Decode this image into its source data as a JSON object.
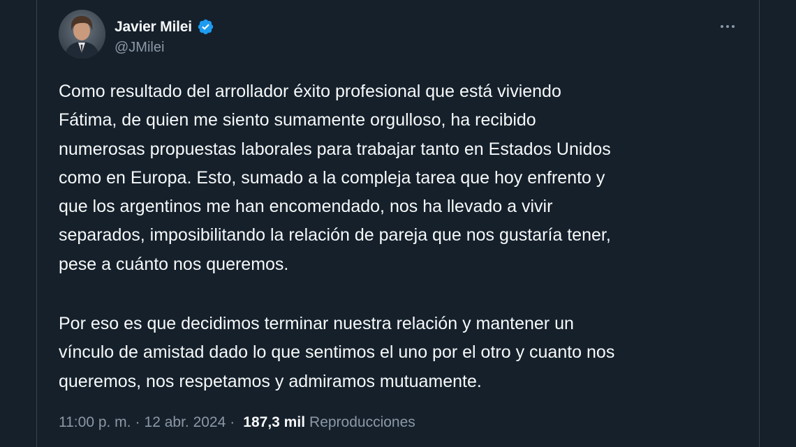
{
  "author": {
    "name": "Javier Milei",
    "handle": "@JMilei",
    "avatar_icon": "profile-photo",
    "verified_icon": "verified-badge-icon",
    "verified_color": "#1d9bf0"
  },
  "tweet": {
    "paragraph_1": "Como resultado del arrollador éxito profesional que está viviendo\nFátima, de quien me siento sumamente orgulloso, ha recibido\nnumerosas propuestas laborales para trabajar tanto en Estados Unidos\ncomo en Europa. Esto, sumado a la compleja tarea que hoy enfrento y\nque los argentinos me han encomendado, nos ha llevado a vivir\nseparados, imposibilitando la relación de pareja que nos gustaría tener,\npese a cuánto nos queremos.",
    "paragraph_2": "Por eso es que decidimos terminar nuestra relación y mantener un\nvínculo de amistad dado lo que sentimos el uno por el otro y cuanto nos\nqueremos, nos respetamos y admiramos mutuamente."
  },
  "meta": {
    "time": "11:00 p. m.",
    "separator": "·",
    "date": "12 abr. 2024",
    "views_count": "187,3 mil",
    "views_label": "Reproducciones"
  },
  "colors": {
    "background": "#15202b",
    "text_primary": "#f7f9f9",
    "text_secondary": "#8b98a5",
    "border": "#38444d"
  }
}
